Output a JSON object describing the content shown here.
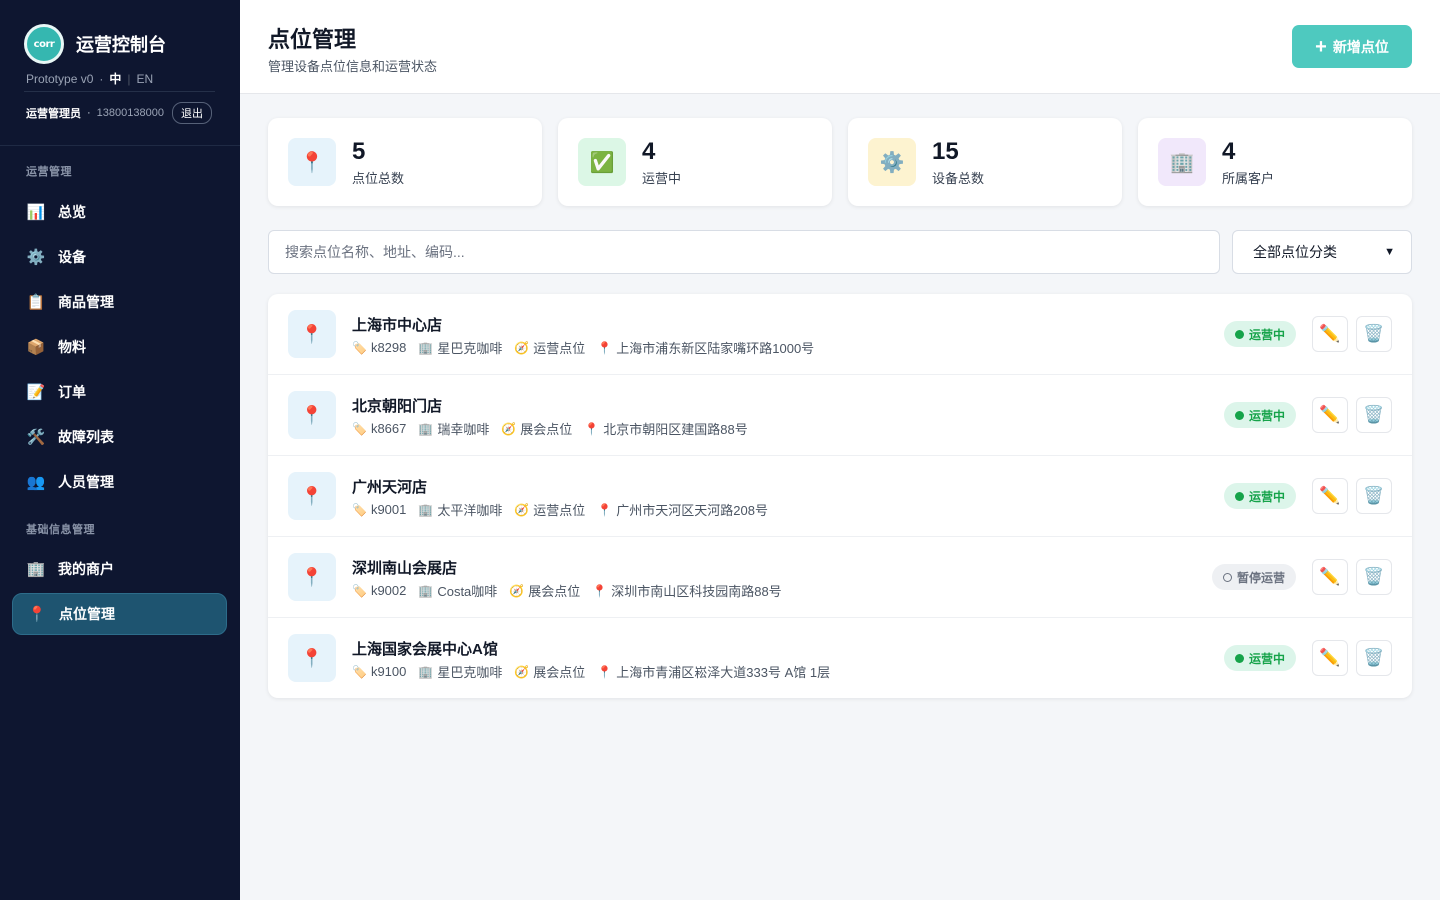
{
  "sidebar": {
    "logo_text": "corr",
    "title": "运营控制台",
    "version": "Prototype v0",
    "lang_zh": "中",
    "lang_en": "EN",
    "user_role": "运营管理员",
    "user_phone": "13800138000",
    "logout": "退出",
    "section_ops": "运营管理",
    "section_basic": "基础信息管理",
    "items": [
      {
        "label": "总览",
        "icon": "bar-chart-icon",
        "glyph": "📊"
      },
      {
        "label": "设备",
        "icon": "gear-icon",
        "glyph": "⚙️"
      },
      {
        "label": "商品管理",
        "icon": "clipboard-icon",
        "glyph": "📋"
      },
      {
        "label": "物料",
        "icon": "package-icon",
        "glyph": "📦"
      },
      {
        "label": "订单",
        "icon": "memo-icon",
        "glyph": "📝"
      },
      {
        "label": "故障列表",
        "icon": "tools-icon",
        "glyph": "🛠️"
      },
      {
        "label": "人员管理",
        "icon": "people-icon",
        "glyph": "👥"
      },
      {
        "label": "我的商户",
        "icon": "office-icon",
        "glyph": "🏢"
      },
      {
        "label": "点位管理",
        "icon": "pin-icon",
        "glyph": "📍",
        "active": true
      }
    ]
  },
  "header": {
    "title": "点位管理",
    "subtitle": "管理设备点位信息和运营状态",
    "add_button": "新增点位"
  },
  "stats": [
    {
      "value": "5",
      "label": "点位总数",
      "icon": "pin-icon",
      "glyph": "📍",
      "bg": "#e6f3fb"
    },
    {
      "value": "4",
      "label": "运营中",
      "icon": "check-icon",
      "glyph": "✅",
      "bg": "#dcf7e6"
    },
    {
      "value": "15",
      "label": "设备总数",
      "icon": "gear-icon",
      "glyph": "⚙️",
      "bg": "#fdf3d0"
    },
    {
      "value": "4",
      "label": "所属客户",
      "icon": "office-icon",
      "glyph": "🏢",
      "bg": "#f1e8fb"
    }
  ],
  "search": {
    "placeholder": "搜索点位名称、地址、编码..."
  },
  "filter": {
    "selected": "全部点位分类"
  },
  "locations": [
    {
      "name": "上海市中心店",
      "code": "k8298",
      "customer": "星巴克咖啡",
      "type": "运营点位",
      "address": "上海市浦东新区陆家嘴环路1000号",
      "status": "运营中",
      "status_kind": "running"
    },
    {
      "name": "北京朝阳门店",
      "code": "k8667",
      "customer": "瑞幸咖啡",
      "type": "展会点位",
      "address": "北京市朝阳区建国路88号",
      "status": "运营中",
      "status_kind": "running"
    },
    {
      "name": "广州天河店",
      "code": "k9001",
      "customer": "太平洋咖啡",
      "type": "运营点位",
      "address": "广州市天河区天河路208号",
      "status": "运营中",
      "status_kind": "running"
    },
    {
      "name": "深圳南山会展店",
      "code": "k9002",
      "customer": "Costa咖啡",
      "type": "展会点位",
      "address": "深圳市南山区科技园南路88号",
      "status": "暂停运营",
      "status_kind": "paused"
    },
    {
      "name": "上海国家会展中心A馆",
      "code": "k9100",
      "customer": "星巴克咖啡",
      "type": "展会点位",
      "address": "上海市青浦区崧泽大道333号 A馆 1层",
      "status": "运营中",
      "status_kind": "running"
    }
  ],
  "icons": {
    "tag": "🏷️",
    "building": "🏢",
    "compass": "🧭",
    "pin": "📍",
    "edit": "✏️",
    "delete": "🗑️",
    "plus": "+"
  },
  "colors": {
    "sidebar_bg": "#0e1630",
    "accent": "#4ec9bf",
    "active_nav": "#1e5470",
    "running": "#16a34a",
    "paused": "#6b7280"
  }
}
